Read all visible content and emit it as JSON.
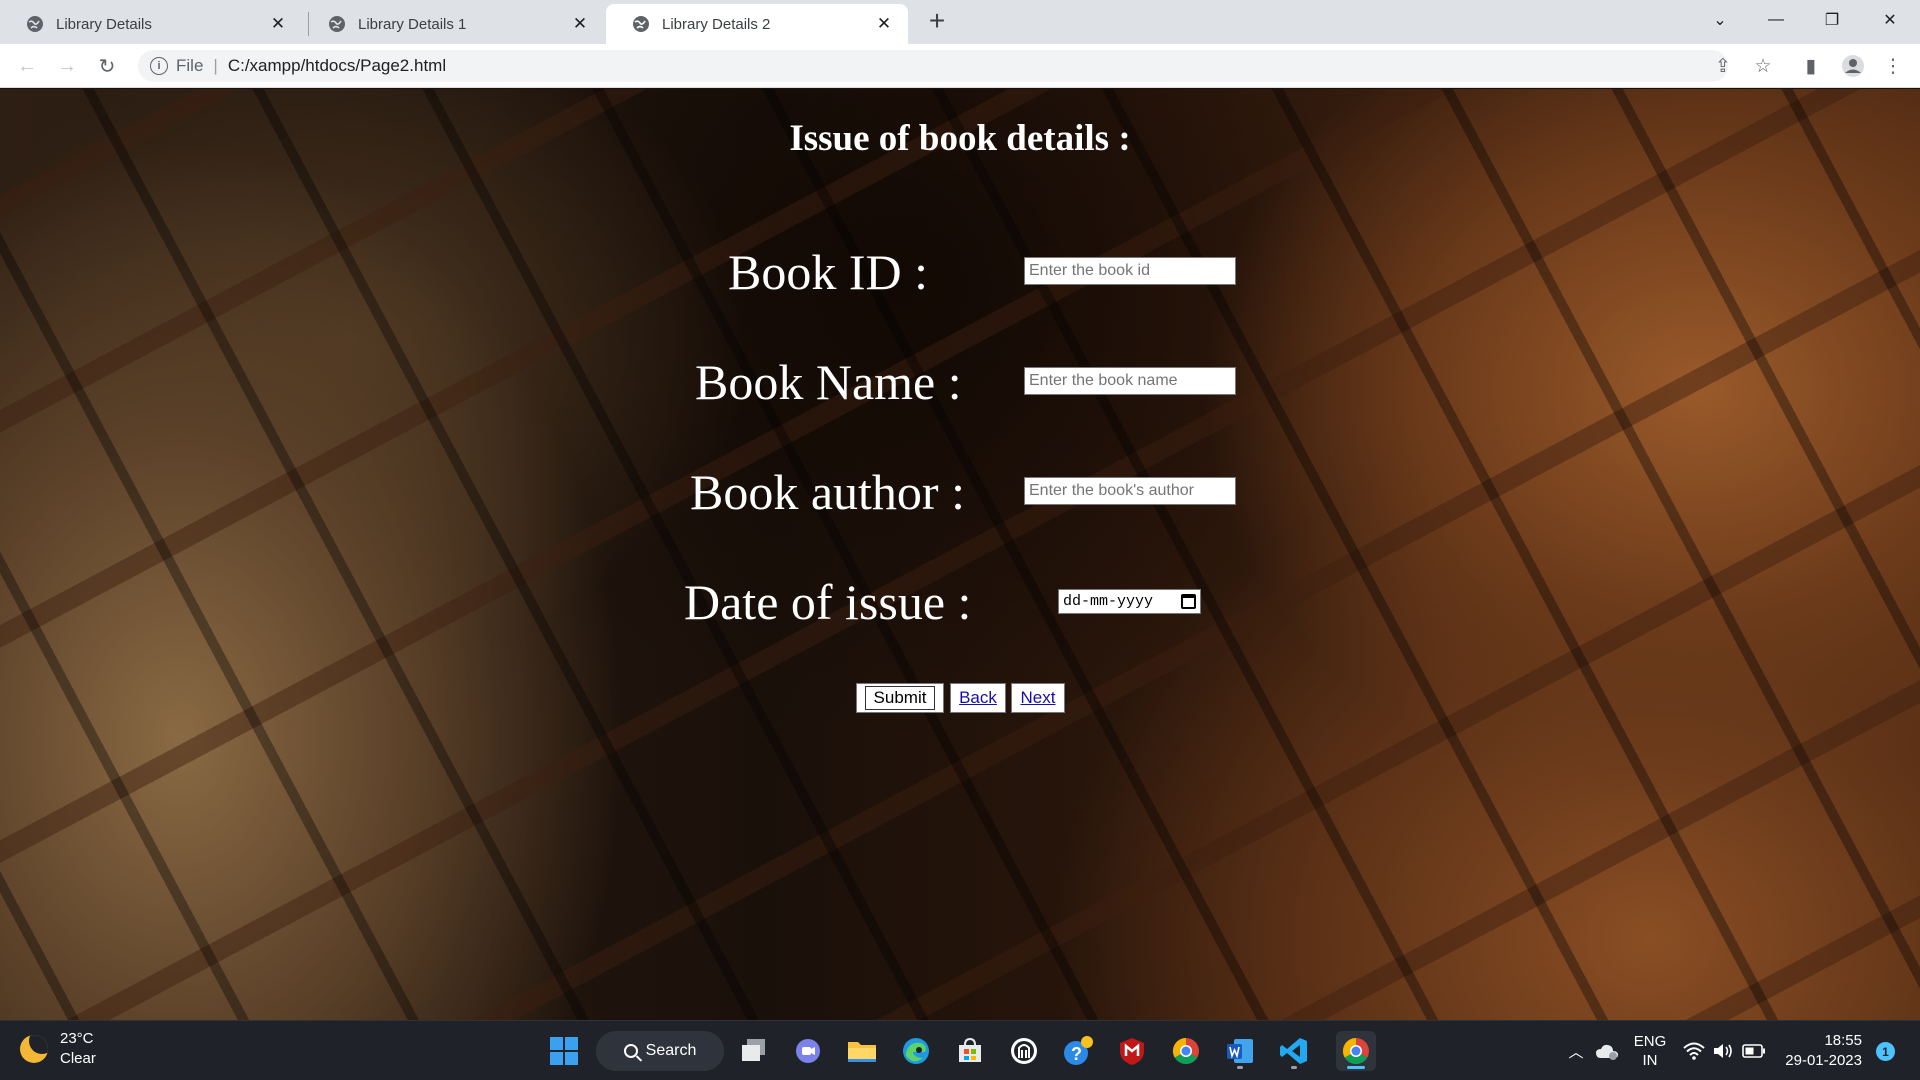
{
  "browser": {
    "tabs": [
      {
        "title": "Library Details",
        "active": false
      },
      {
        "title": "Library Details 1",
        "active": false
      },
      {
        "title": "Library Details 2",
        "active": true
      }
    ],
    "address": {
      "scheme_label": "File",
      "url": "C:/xampp/htdocs/Page2.html"
    }
  },
  "page": {
    "heading": "Issue of book details :",
    "fields": {
      "book_id": {
        "label": "Book ID :",
        "placeholder": "Enter the book id"
      },
      "book_name": {
        "label": "Book Name :",
        "placeholder": "Enter the book name"
      },
      "book_author": {
        "label": "Book author :",
        "placeholder": "Enter the book's author"
      },
      "date_of_issue": {
        "label": "Date of issue :",
        "value": "dd-mm-yyyy"
      }
    },
    "buttons": {
      "submit": "Submit",
      "back": "Back",
      "next": "Next"
    },
    "colors": {
      "link": "#1a0dab",
      "text": "#ffffff"
    }
  },
  "taskbar": {
    "weather": {
      "temp": "23°C",
      "condition": "Clear"
    },
    "search_label": "Search",
    "language": {
      "lang": "ENG",
      "region": "IN"
    },
    "clock": {
      "time": "18:55",
      "date": "29-01-2023"
    },
    "notification_count": "1",
    "apps": [
      "windows-start",
      "search",
      "task-view",
      "teams",
      "file-explorer",
      "edge",
      "microsoft-store",
      "app-dark",
      "tips",
      "mcafee",
      "chrome",
      "word",
      "vscode",
      "chrome-active"
    ]
  }
}
